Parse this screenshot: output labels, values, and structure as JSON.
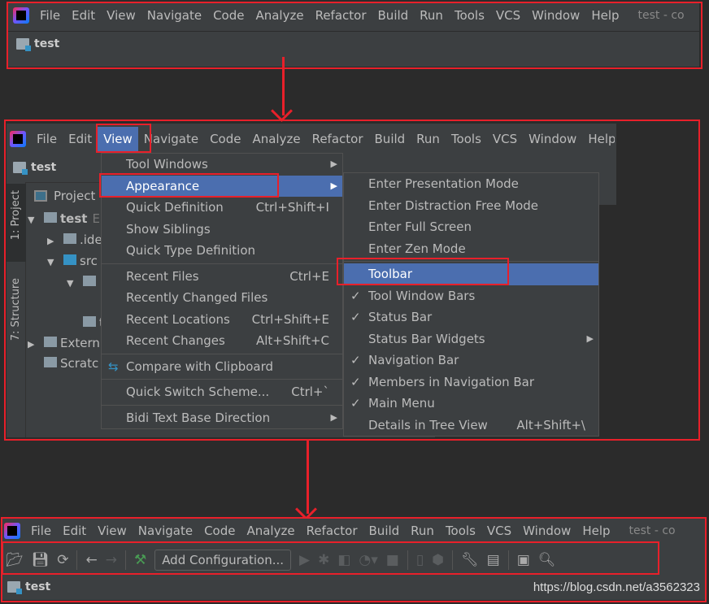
{
  "menu_labels": [
    "File",
    "Edit",
    "View",
    "Navigate",
    "Code",
    "Analyze",
    "Refactor",
    "Build",
    "Run",
    "Tools",
    "VCS",
    "Window",
    "Help"
  ],
  "window_title": "test - co",
  "project_name": "test",
  "project_panel": {
    "tab_project": "1: Project",
    "tab_structure": "7: Structure",
    "header": "Project",
    "tree": [
      {
        "label": "test",
        "suffix": "E:",
        "arrow": "▼"
      },
      {
        "label": ".ide",
        "arrow": "▶"
      },
      {
        "label": "src",
        "arrow": "▼"
      },
      {
        "label": "",
        "arrow": "▼"
      },
      {
        "label": "tes",
        "arrow": ""
      },
      {
        "label": "Extern",
        "arrow": "▶"
      },
      {
        "label": "Scratc",
        "arrow": ""
      }
    ]
  },
  "view_menu": [
    {
      "label": "Tool Windows",
      "submenu": true
    },
    {
      "label": "Appearance",
      "submenu": true,
      "selected": true
    },
    {
      "label": "Quick Definition",
      "shortcut": "Ctrl+Shift+I"
    },
    {
      "label": "Show Siblings"
    },
    {
      "label": "Quick Type Definition"
    },
    {
      "sep": true
    },
    {
      "label": "Recent Files",
      "shortcut": "Ctrl+E"
    },
    {
      "label": "Recently Changed Files"
    },
    {
      "label": "Recent Locations",
      "shortcut": "Ctrl+Shift+E"
    },
    {
      "label": "Recent Changes",
      "shortcut": "Alt+Shift+C"
    },
    {
      "sep": true
    },
    {
      "label": "Compare with Clipboard",
      "icon": "compare-icon"
    },
    {
      "sep": true
    },
    {
      "label": "Quick Switch Scheme...",
      "shortcut": "Ctrl+`"
    },
    {
      "sep": true
    },
    {
      "label": "Bidi Text Base Direction",
      "submenu": true
    }
  ],
  "appearance_menu": [
    {
      "label": "Enter Presentation Mode"
    },
    {
      "label": "Enter Distraction Free Mode"
    },
    {
      "label": "Enter Full Screen"
    },
    {
      "label": "Enter Zen Mode"
    },
    {
      "sep": true
    },
    {
      "label": "Toolbar",
      "selected": true
    },
    {
      "label": "Tool Window Bars",
      "checked": true
    },
    {
      "label": "Status Bar",
      "checked": true
    },
    {
      "label": "Status Bar Widgets",
      "submenu": true
    },
    {
      "label": "Navigation Bar",
      "checked": true
    },
    {
      "label": "Members in Navigation Bar",
      "checked": true
    },
    {
      "label": "Main Menu",
      "checked": true
    },
    {
      "label": "Details in Tree View",
      "shortcut": "Alt+Shift+\\"
    }
  ],
  "toolbar": {
    "add_configuration": "Add Configuration..."
  },
  "watermark": "https://blog.csdn.net/a3562323",
  "colors": {
    "accent": "#4b6eaf",
    "highlight_box": "#e8202a",
    "background": "#3c3f41"
  }
}
